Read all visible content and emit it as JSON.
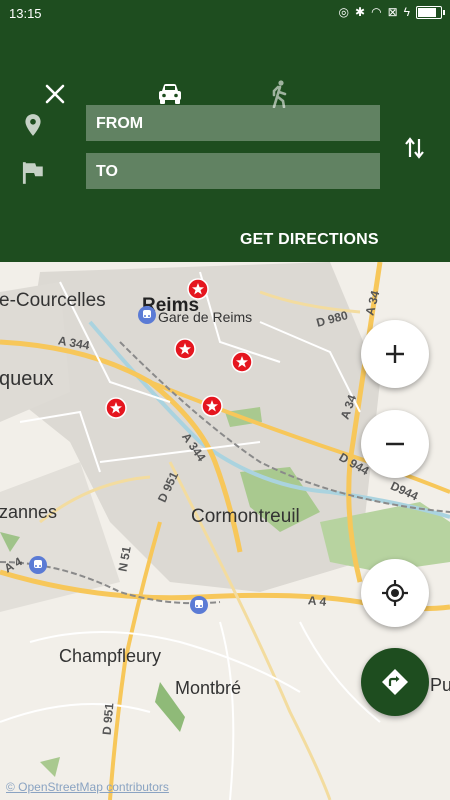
{
  "status_bar": {
    "time": "13:15"
  },
  "header": {
    "from_placeholder": "FROM",
    "to_placeholder": "TO",
    "get_directions_label": "GET DIRECTIONS"
  },
  "map": {
    "place_labels": {
      "reims": "Reims",
      "gare": "Gare de Reims",
      "courcelles": "e-Courcelles",
      "queux": "queux",
      "zannes": "zannes",
      "cormontreuil": "Cormontreuil",
      "champfleury": "Champfleury",
      "montbre": "Montbré",
      "pu": "Pu"
    },
    "road_labels": {
      "a344_1": "A 344",
      "a344_2": "A 344",
      "d980": "D 980",
      "a34_1": "A 34",
      "a34_2": "A 34",
      "d944_1": "D 944",
      "d944_2": "D944",
      "d951_1": "D 951",
      "n51": "N 51",
      "a4_1": "A 4",
      "a4_2": "A 4",
      "d951_2": "D 951"
    },
    "attribution": "© OpenStreetMap contributors"
  },
  "colors": {
    "header_bg": "#1e4d1f",
    "marker_red": "#e5161f",
    "highway": "#f7c75a",
    "rail_icon": "#5b7bd5"
  }
}
